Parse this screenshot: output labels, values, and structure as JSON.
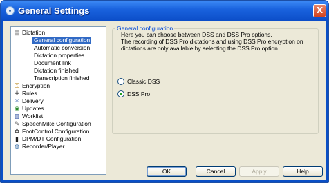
{
  "window": {
    "title": "General Settings",
    "close_label": "X"
  },
  "tree": {
    "items": [
      {
        "label": "Dictation",
        "icon": "dictation-icon",
        "glyph": "▤",
        "color": "#6b6b6b"
      },
      {
        "label": "General configuration",
        "selected": true
      },
      {
        "label": "Automatic conversion"
      },
      {
        "label": "Dictation properties"
      },
      {
        "label": "Document link"
      },
      {
        "label": "Dictation finished"
      },
      {
        "label": "Transcription finished"
      },
      {
        "label": "Encryption",
        "icon": "key-icon",
        "glyph": "⚿",
        "color": "#b07a00"
      },
      {
        "label": "Rules",
        "icon": "rules-icon",
        "glyph": "✚",
        "color": "#333333"
      },
      {
        "label": "Delivery",
        "icon": "envelope-icon",
        "glyph": "✉",
        "color": "#4a6fb0"
      },
      {
        "label": "Updates",
        "icon": "updates-icon",
        "glyph": "◉",
        "color": "#2a8a2a"
      },
      {
        "label": "Worklist",
        "icon": "worklist-icon",
        "glyph": "▥",
        "color": "#3050a0"
      },
      {
        "label": "SpeechMike Configuration",
        "icon": "speechmike-icon",
        "glyph": "✎",
        "color": "#555555"
      },
      {
        "label": "FootControl Configuration",
        "icon": "footcontrol-icon",
        "glyph": "✿",
        "color": "#444444"
      },
      {
        "label": "DPM/DT Configuration",
        "icon": "dpm-icon",
        "glyph": "▮",
        "color": "#222222"
      },
      {
        "label": "Recorder/Player",
        "icon": "recorder-icon",
        "glyph": "◍",
        "color": "#3a6ea5"
      }
    ]
  },
  "config": {
    "group_label": "General configuration",
    "description_line1": "Here you can choose between DSS and DSS Pro options.",
    "description_line2": "The recording of DSS Pro dictations and using DSS Pro encryption on",
    "description_line3": "dictations are only available by selecting the DSS Pro option.",
    "options": [
      {
        "label": "Classic DSS",
        "checked": false
      },
      {
        "label": "DSS Pro",
        "checked": true
      }
    ]
  },
  "buttons": {
    "ok": "OK",
    "cancel": "Cancel",
    "apply": "Apply",
    "help": "Help"
  }
}
